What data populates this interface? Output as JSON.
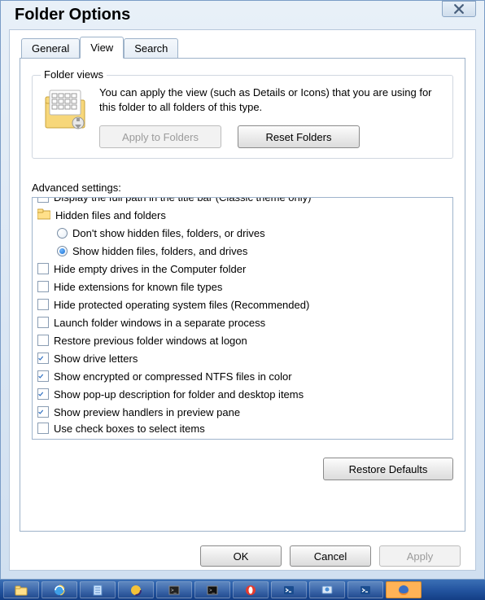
{
  "window": {
    "title": "Folder Options"
  },
  "tabs": [
    {
      "label": "General"
    },
    {
      "label": "View"
    },
    {
      "label": "Search"
    }
  ],
  "folder_views": {
    "group_title": "Folder views",
    "description": "You can apply the view (such as Details or Icons) that you are using for this folder to all folders of this type.",
    "apply_label": "Apply to Folders",
    "reset_label": "Reset Folders"
  },
  "advanced": {
    "label": "Advanced settings:",
    "items": [
      {
        "kind": "checkbox",
        "checked": false,
        "label": "Display the full path in the title bar (Classic theme only)"
      },
      {
        "kind": "folder",
        "label": "Hidden files and folders"
      },
      {
        "kind": "radio",
        "selected": false,
        "indent": true,
        "label": "Don't show hidden files, folders, or drives"
      },
      {
        "kind": "radio",
        "selected": true,
        "indent": true,
        "label": "Show hidden files, folders, and drives"
      },
      {
        "kind": "checkbox",
        "checked": false,
        "label": "Hide empty drives in the Computer folder"
      },
      {
        "kind": "checkbox",
        "checked": false,
        "label": "Hide extensions for known file types"
      },
      {
        "kind": "checkbox",
        "checked": false,
        "label": "Hide protected operating system files (Recommended)"
      },
      {
        "kind": "checkbox",
        "checked": false,
        "label": "Launch folder windows in a separate process"
      },
      {
        "kind": "checkbox",
        "checked": false,
        "label": "Restore previous folder windows at logon"
      },
      {
        "kind": "checkbox",
        "checked": true,
        "label": "Show drive letters"
      },
      {
        "kind": "checkbox",
        "checked": true,
        "label": "Show encrypted or compressed NTFS files in color"
      },
      {
        "kind": "checkbox",
        "checked": true,
        "label": "Show pop-up description for folder and desktop items"
      },
      {
        "kind": "checkbox",
        "checked": true,
        "label": "Show preview handlers in preview pane"
      },
      {
        "kind": "checkbox",
        "checked": false,
        "label": "Use check boxes to select items",
        "cutoff": true
      }
    ],
    "restore_label": "Restore Defaults"
  },
  "footer": {
    "ok": "OK",
    "cancel": "Cancel",
    "apply": "Apply"
  },
  "taskbar": {
    "items": [
      "explorer",
      "ie",
      "notepad",
      "eclipse",
      "terminal1",
      "terminal2",
      "opera",
      "powershell",
      "rdp",
      "powershell2",
      "firefox"
    ]
  }
}
